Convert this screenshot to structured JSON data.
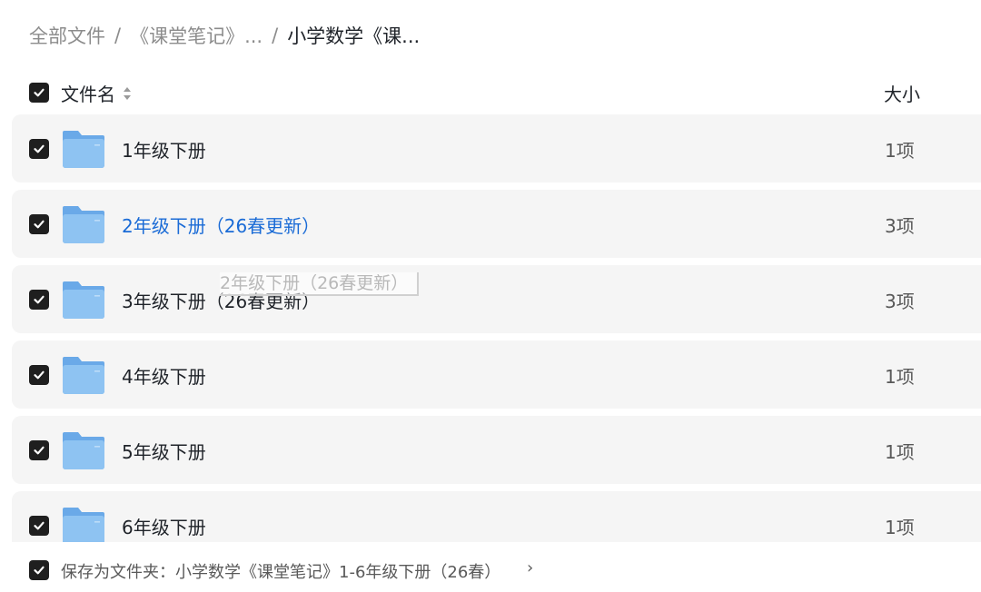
{
  "breadcrumb": {
    "items": [
      "全部文件",
      "《课堂笔记》...",
      "小学数学《课..."
    ],
    "separator": "/"
  },
  "header": {
    "name_label": "文件名",
    "size_label": "大小"
  },
  "rows": [
    {
      "name": "1年级下册",
      "size": "1项"
    },
    {
      "name": "2年级下册（26春更新）",
      "size": "3项"
    },
    {
      "name": "3年级下册（26春更新）",
      "size": "3项"
    },
    {
      "name": "4年级下册",
      "size": "1项"
    },
    {
      "name": "5年级下册",
      "size": "1项"
    },
    {
      "name": "6年级下册",
      "size": "1项"
    }
  ],
  "drag_ghost": {
    "label": "2年级下册（26春更新）"
  },
  "footer": {
    "save_label": "保存为文件夹：小学数学《课堂笔记》1-6年级下册（26春）",
    "chevron": "›"
  },
  "colors": {
    "accent": "#1a6bd6",
    "row_bg": "#f5f5f5",
    "checkbox": "#1f1f1f",
    "folder": "#7fb6ec"
  }
}
